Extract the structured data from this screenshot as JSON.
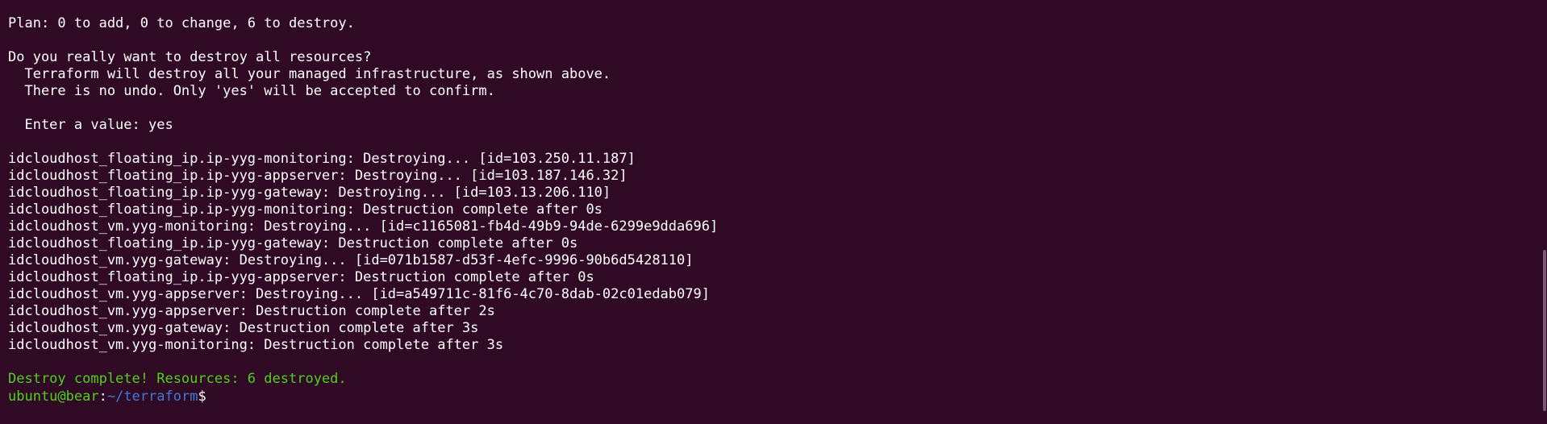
{
  "terminal": {
    "lines": [
      "Plan: 0 to add, 0 to change, 6 to destroy.",
      "",
      "Do you really want to destroy all resources?",
      "  Terraform will destroy all your managed infrastructure, as shown above.",
      "  There is no undo. Only 'yes' will be accepted to confirm.",
      "",
      "  Enter a value: yes",
      "",
      "idcloudhost_floating_ip.ip-yyg-monitoring: Destroying... [id=103.250.11.187]",
      "idcloudhost_floating_ip.ip-yyg-appserver: Destroying... [id=103.187.146.32]",
      "idcloudhost_floating_ip.ip-yyg-gateway: Destroying... [id=103.13.206.110]",
      "idcloudhost_floating_ip.ip-yyg-monitoring: Destruction complete after 0s",
      "idcloudhost_vm.yyg-monitoring: Destroying... [id=c1165081-fb4d-49b9-94de-6299e9dda696]",
      "idcloudhost_floating_ip.ip-yyg-gateway: Destruction complete after 0s",
      "idcloudhost_vm.yyg-gateway: Destroying... [id=071b1587-d53f-4efc-9996-90b6d5428110]",
      "idcloudhost_floating_ip.ip-yyg-appserver: Destruction complete after 0s",
      "idcloudhost_vm.yyg-appserver: Destroying... [id=a549711c-81f6-4c70-8dab-02c01edab079]",
      "idcloudhost_vm.yyg-appserver: Destruction complete after 2s",
      "idcloudhost_vm.yyg-gateway: Destruction complete after 3s",
      "idcloudhost_vm.yyg-monitoring: Destruction complete after 3s",
      ""
    ],
    "success_message": "Destroy complete! Resources: 6 destroyed.",
    "prompt": {
      "user_host": "ubuntu@bear",
      "separator": ":",
      "path": "~/terraform",
      "symbol": "$"
    }
  },
  "colors": {
    "background": "#300a24",
    "text": "#ffffff",
    "success": "#4ed21a",
    "path": "#3f7bd8"
  }
}
